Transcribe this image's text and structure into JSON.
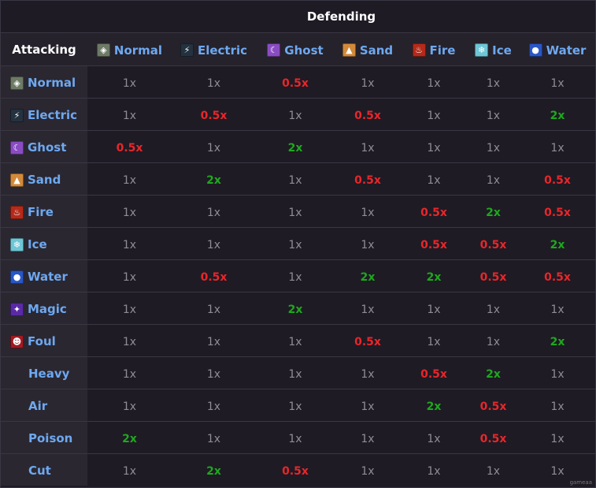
{
  "header": {
    "defending_label": "Defending",
    "attacking_label": "Attacking"
  },
  "defending_types": [
    {
      "name": "Normal",
      "icon": "normal-type-icon",
      "glyph": "◈",
      "bg": "#6d7a66"
    },
    {
      "name": "Electric",
      "icon": "electric-type-icon",
      "glyph": "⚡",
      "bg": "#243240"
    },
    {
      "name": "Ghost",
      "icon": "ghost-type-icon",
      "glyph": "☾",
      "bg": "#8a4cc2"
    },
    {
      "name": "Sand",
      "icon": "sand-type-icon",
      "glyph": "▲",
      "bg": "#d28a3a"
    },
    {
      "name": "Fire",
      "icon": "fire-type-icon",
      "glyph": "♨",
      "bg": "#b52a1a"
    },
    {
      "name": "Ice",
      "icon": "ice-type-icon",
      "glyph": "❄",
      "bg": "#6ec6d6"
    },
    {
      "name": "Water",
      "icon": "water-type-icon",
      "glyph": "●",
      "bg": "#2a56c6"
    }
  ],
  "attacking_rows": [
    {
      "name": "Normal",
      "icon": "normal-type-icon",
      "glyph": "◈",
      "bg": "#6d7a66",
      "values": [
        "1x",
        "1x",
        "0.5x",
        "1x",
        "1x",
        "1x",
        "1x"
      ]
    },
    {
      "name": "Electric",
      "icon": "electric-type-icon",
      "glyph": "⚡",
      "bg": "#243240",
      "values": [
        "1x",
        "0.5x",
        "1x",
        "0.5x",
        "1x",
        "1x",
        "2x"
      ]
    },
    {
      "name": "Ghost",
      "icon": "ghost-type-icon",
      "glyph": "☾",
      "bg": "#8a4cc2",
      "values": [
        "0.5x",
        "1x",
        "2x",
        "1x",
        "1x",
        "1x",
        "1x"
      ]
    },
    {
      "name": "Sand",
      "icon": "sand-type-icon",
      "glyph": "▲",
      "bg": "#d28a3a",
      "values": [
        "1x",
        "2x",
        "1x",
        "0.5x",
        "1x",
        "1x",
        "0.5x"
      ]
    },
    {
      "name": "Fire",
      "icon": "fire-type-icon",
      "glyph": "♨",
      "bg": "#b52a1a",
      "values": [
        "1x",
        "1x",
        "1x",
        "1x",
        "0.5x",
        "2x",
        "0.5x"
      ]
    },
    {
      "name": "Ice",
      "icon": "ice-type-icon",
      "glyph": "❄",
      "bg": "#6ec6d6",
      "values": [
        "1x",
        "1x",
        "1x",
        "1x",
        "0.5x",
        "0.5x",
        "2x"
      ]
    },
    {
      "name": "Water",
      "icon": "water-type-icon",
      "glyph": "●",
      "bg": "#2a56c6",
      "values": [
        "1x",
        "0.5x",
        "1x",
        "2x",
        "2x",
        "0.5x",
        "0.5x"
      ]
    },
    {
      "name": "Magic",
      "icon": "magic-type-icon",
      "glyph": "✦",
      "bg": "#5a2aa6",
      "values": [
        "1x",
        "1x",
        "2x",
        "1x",
        "1x",
        "1x",
        "1x"
      ]
    },
    {
      "name": "Foul",
      "icon": "foul-type-icon",
      "glyph": "☻",
      "bg": "#a11a22",
      "values": [
        "1x",
        "1x",
        "1x",
        "0.5x",
        "1x",
        "1x",
        "2x"
      ]
    },
    {
      "name": "Heavy",
      "icon": "",
      "glyph": "",
      "bg": "",
      "values": [
        "1x",
        "1x",
        "1x",
        "1x",
        "0.5x",
        "2x",
        "1x"
      ]
    },
    {
      "name": "Air",
      "icon": "",
      "glyph": "",
      "bg": "",
      "values": [
        "1x",
        "1x",
        "1x",
        "1x",
        "2x",
        "0.5x",
        "1x"
      ]
    },
    {
      "name": "Poison",
      "icon": "",
      "glyph": "",
      "bg": "",
      "values": [
        "2x",
        "1x",
        "1x",
        "1x",
        "1x",
        "0.5x",
        "1x"
      ]
    },
    {
      "name": "Cut",
      "icon": "",
      "glyph": "",
      "bg": "",
      "values": [
        "1x",
        "2x",
        "0.5x",
        "1x",
        "1x",
        "1x",
        "1x"
      ]
    }
  ],
  "value_colors": {
    "neutral": "#8e8c96",
    "weak": "#e8262a",
    "strong": "#1ea81e",
    "type_label": "#6ea8f0"
  }
}
